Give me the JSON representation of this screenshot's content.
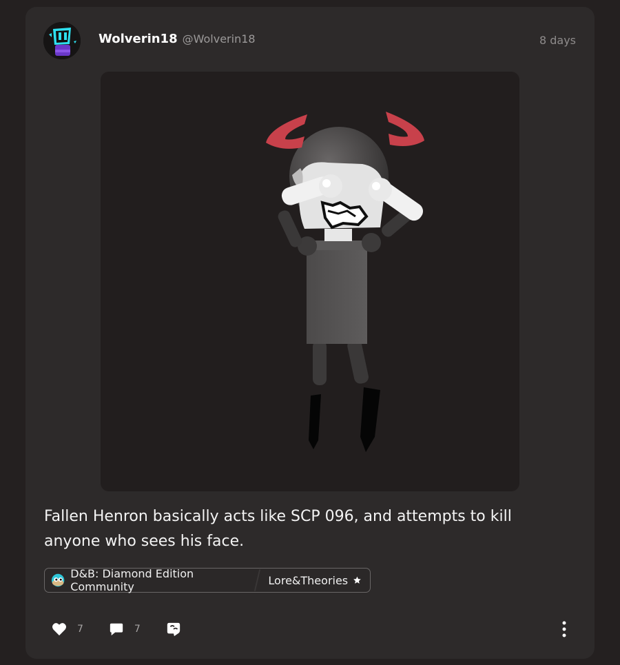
{
  "post": {
    "author_name": "Wolverin18",
    "author_handle": "@Wolverin18",
    "time_ago": "8 days",
    "text": "Fallen Henron basically acts like SCP 096, and attempts to kill anyone who sees his face.",
    "community": "D&B: Diamond Edition Community",
    "category": "Lore&Theories"
  },
  "actions": {
    "likes": "7",
    "comments": "7"
  },
  "icons": {
    "like": "heart-icon",
    "comment": "comment-bubble-icon",
    "share": "repost-icon",
    "more": "more-vertical-icon",
    "category": "star-icon"
  },
  "colors": {
    "page_bg": "#242020",
    "card_bg": "#2d2a2a",
    "media_bg": "#221e1e",
    "horn_red": "#c8414b",
    "avatar_cyan": "#2ee0ef",
    "avatar_purple": "#6a38c9"
  }
}
